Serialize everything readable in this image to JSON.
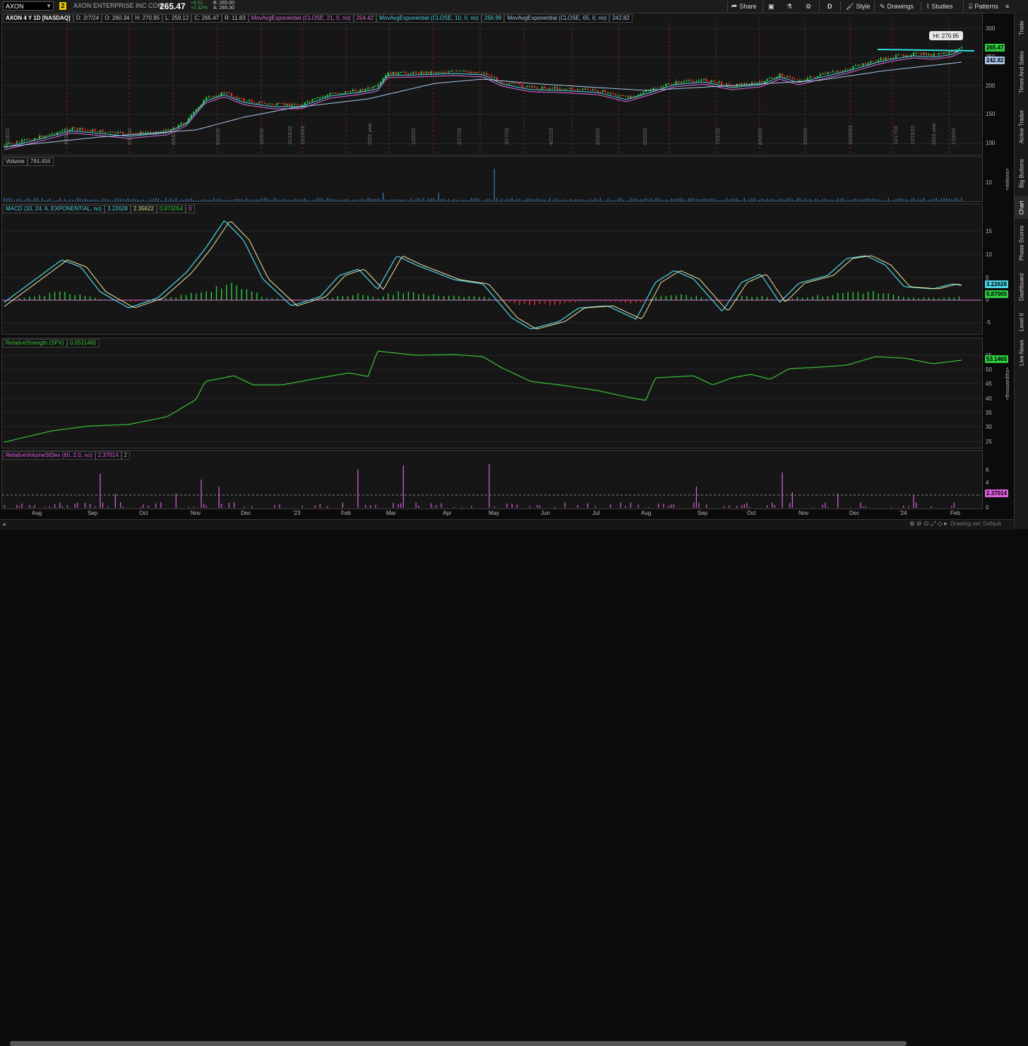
{
  "toolbar": {
    "symbol": "AXON",
    "link_badge": "2",
    "company": "AXON ENTERPRISE INC COM",
    "last_price": "265.47",
    "change": "+6.01",
    "change_pct": "+2.32%",
    "bid": "B: 265.00",
    "ask": "A: 265.30",
    "buttons": {
      "share": "Share",
      "period": "D",
      "style": "Style",
      "drawings": "Drawings",
      "studies": "Studies",
      "patterns": "Patterns"
    }
  },
  "price_panel": {
    "title": "AXON 4 Y 1D [NASDAQ]",
    "date": "D: 2/7/24",
    "open": "O: 260.34",
    "high": "H: 270.95",
    "low": "L: 259.12",
    "close": "C: 265.47",
    "range": "R: 11.83",
    "studies": [
      {
        "label": "MovAvgExponential (CLOSE, 21, 0, no)",
        "value": "254.42",
        "color": "#e070e0"
      },
      {
        "label": "MovAvgExponential (CLOSE, 10, 0, no)",
        "value": "256.99",
        "color": "#4fd6e8"
      },
      {
        "label": "MovAvgExponential (CLOSE, 65, 0, no)",
        "value": "242.82",
        "color": "#a8c8e8"
      }
    ],
    "hi_callout": "Hi: 270.95",
    "ticks": [
      "300",
      "250",
      "200",
      "150",
      "100"
    ],
    "last_pill": "265.47",
    "ma65_pill": "242.82",
    "date_marks": [
      "3/16/22",
      "4/19/22",
      "5/17/22",
      "6/14/22",
      "8/10/22",
      "10/9/22",
      "11/18/22",
      "12/16/22",
      "2022 year",
      "1/20/23",
      "2/17/23",
      "3/17/23",
      "4/21/23",
      "5/19/23",
      "6/16/23",
      "7/21/23",
      "8/18/23",
      "9/15/23",
      "10/20/23",
      "11/17/23",
      "12/15/23",
      "2023 year",
      "1/19/24",
      "2/16/24"
    ]
  },
  "volume_panel": {
    "title": "Volume",
    "value": "784,494",
    "unit": "<millions>",
    "ticks": [
      "10"
    ]
  },
  "macd_panel": {
    "title": "MACD (10, 24, 6, EXPONENTIAL, no)",
    "v1": "3.22628",
    "v2": "2.35622",
    "v3": "0.870054",
    "v4": "0",
    "ticks": [
      "15",
      "10",
      "5",
      "0",
      "-5"
    ],
    "pill1": "3.22628",
    "pill2": "0.87005"
  },
  "rs_panel": {
    "title": "RelativeStrength (SPX)",
    "value": "0.0531465",
    "unit": "<thousandths>",
    "ticks": [
      "55",
      "50",
      "45",
      "40",
      "35",
      "30",
      "25"
    ],
    "pill": "53.1465"
  },
  "rvsd_panel": {
    "title": "RelativeVolumeStDev (60, 2.0, no)",
    "value": "2.37014",
    "v2": "2",
    "ticks": [
      "6",
      "4",
      "2",
      "0"
    ],
    "pill": "2.37014"
  },
  "x_axis": [
    "Aug",
    "Sep",
    "Oct",
    "Nov",
    "Dec",
    "'23",
    "Feb",
    "Mar",
    "Apr",
    "May",
    "Jun",
    "Jul",
    "Aug",
    "Sep",
    "Oct",
    "Nov",
    "Dec",
    "'24",
    "Feb"
  ],
  "right_tabs": [
    "Trade",
    "Times And Sales",
    "Active Trader",
    "Big Buttons",
    "Chart",
    "Phase Scores",
    "Dashboard",
    "Level II",
    "Live News"
  ],
  "bottom_status": "Drawing set: Default",
  "colors": {
    "up": "#2ecc40",
    "down": "#e83030",
    "ema21": "#e070e0",
    "ema10": "#4fd6e8",
    "ema65": "#a8c8e8",
    "rs": "#39c139",
    "rvsd": "#e060e0",
    "trendline": "#2fe0e0"
  }
}
